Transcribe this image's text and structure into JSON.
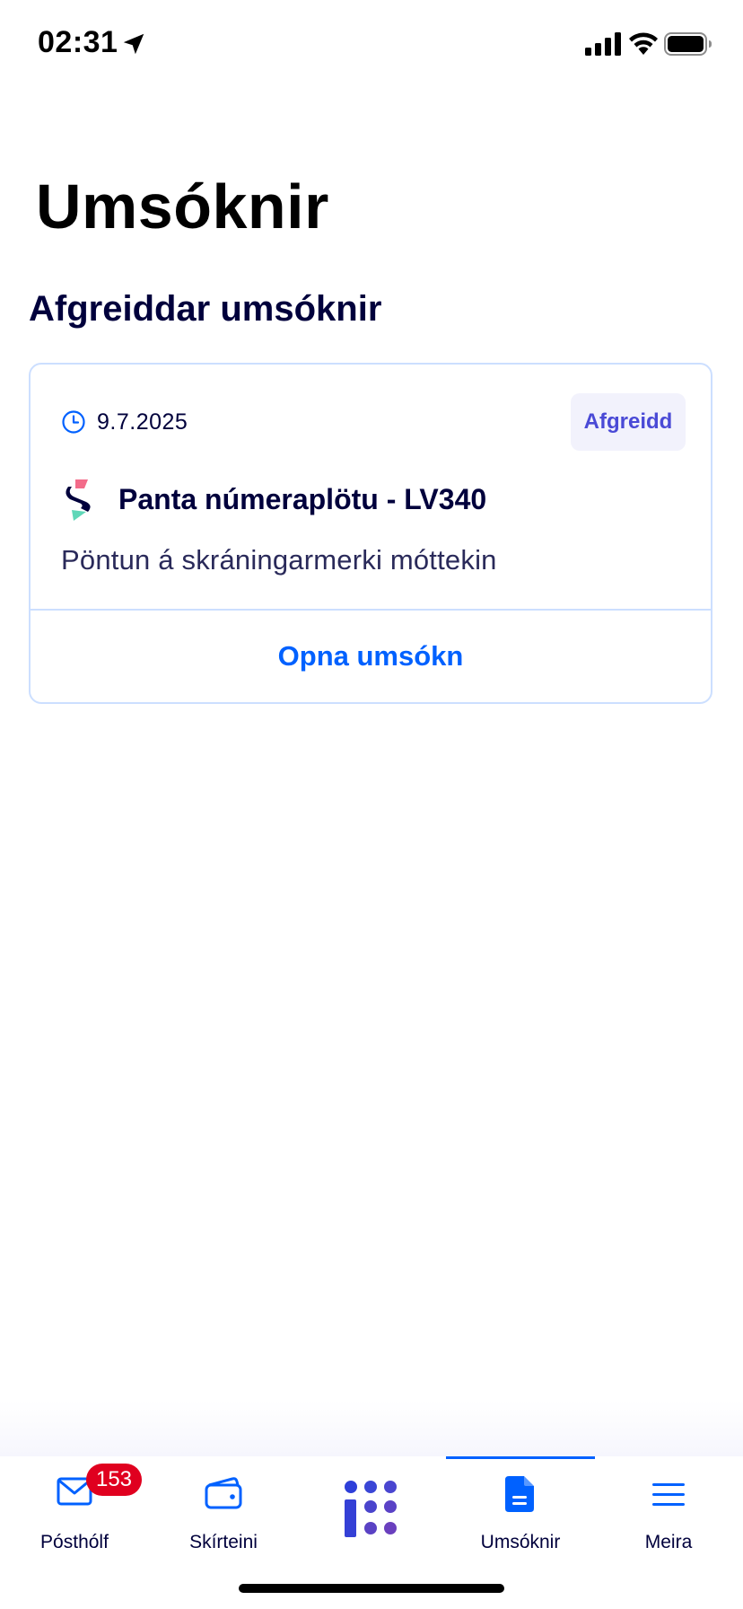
{
  "status_bar": {
    "time": "02:31"
  },
  "page": {
    "title": "Umsóknir",
    "section_title": "Afgreiddar umsóknir"
  },
  "application_card": {
    "date": "9.7.2025",
    "status": "Afgreidd",
    "title": "Panta númeraplötu - LV340",
    "description": "Pöntun á skráningarmerki móttekin",
    "open_label": "Opna umsókn"
  },
  "tab_bar": {
    "tabs": [
      {
        "label": "Pósthólf",
        "icon": "mail-icon",
        "badge": "153"
      },
      {
        "label": "Skírteini",
        "icon": "wallet-icon"
      },
      {
        "label": "",
        "icon": "home-logo-icon"
      },
      {
        "label": "Umsóknir",
        "icon": "document-icon",
        "active": true
      },
      {
        "label": "Meira",
        "icon": "menu-icon"
      }
    ]
  },
  "colors": {
    "primary": "#0061ff",
    "navy": "#00003c",
    "badge_red": "#e0001f",
    "status_purple": "#4a4ad6",
    "card_border": "#ccdfff"
  }
}
